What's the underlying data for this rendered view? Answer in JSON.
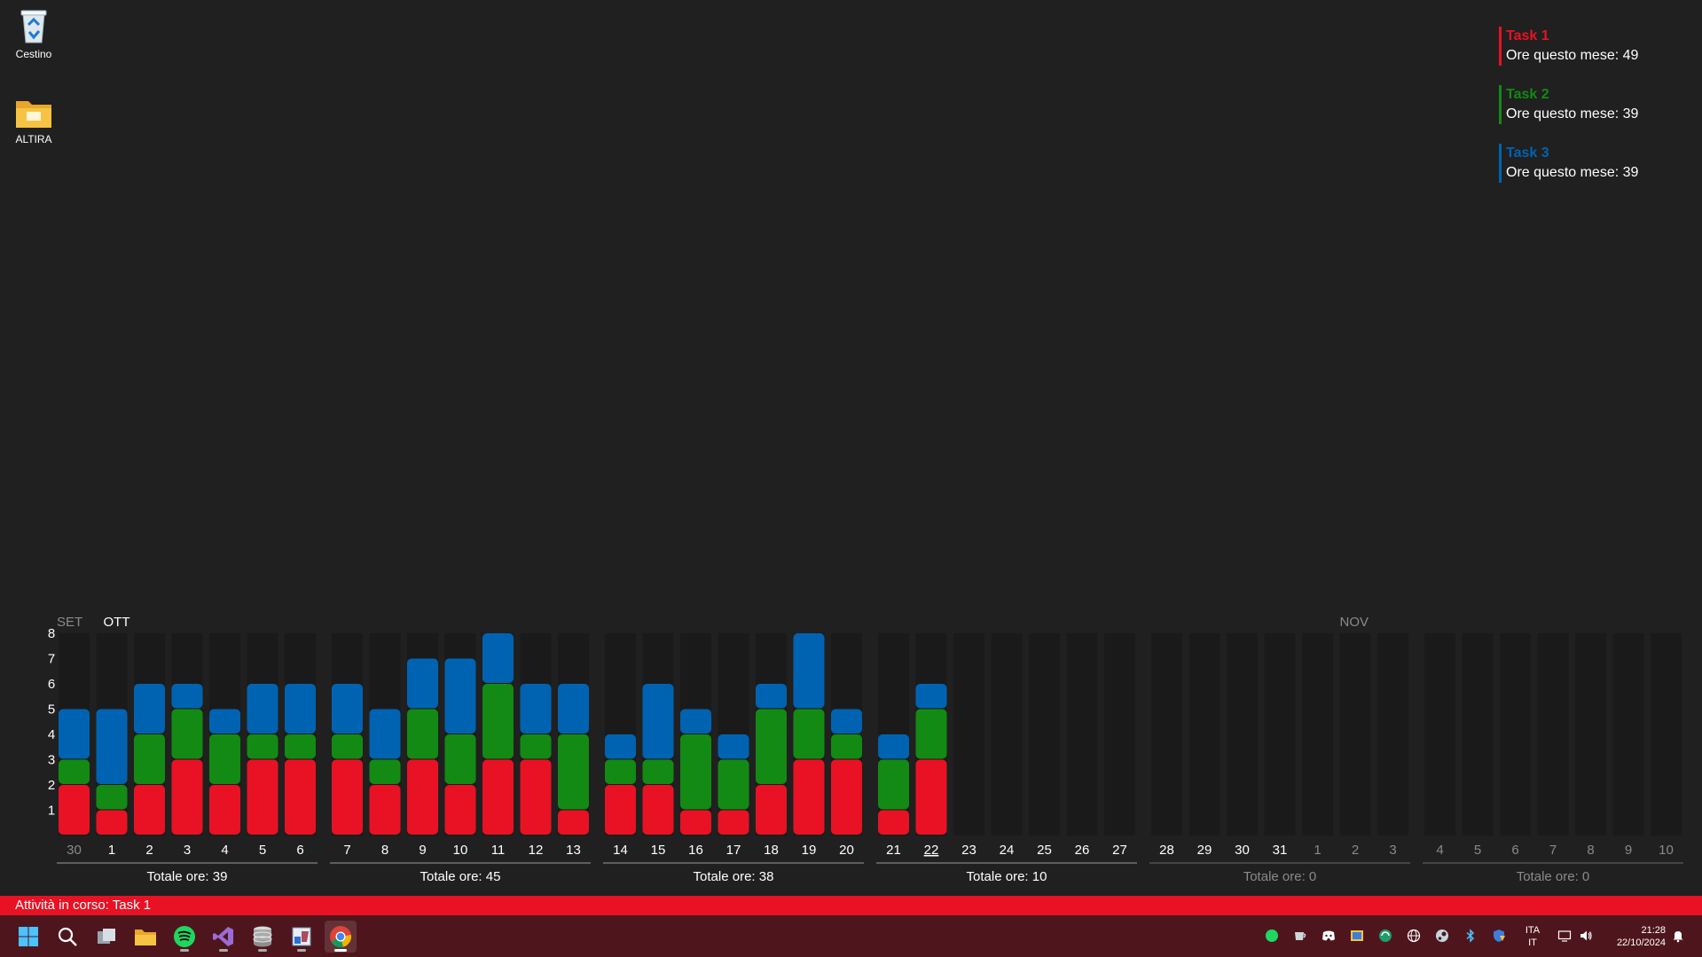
{
  "desktop": {
    "icons": [
      {
        "label": "Cestino"
      },
      {
        "label": "ALTIRA"
      }
    ]
  },
  "legend": {
    "items": [
      {
        "name": "Task 1",
        "hours_text": "Ore questo mese: 49",
        "color": "#e81224"
      },
      {
        "name": "Task 2",
        "hours_text": "Ore questo mese: 39",
        "color": "#138a13"
      },
      {
        "name": "Task 3",
        "hours_text": "Ore questo mese: 39",
        "color": "#0063b1"
      }
    ]
  },
  "chart_data": {
    "type": "bar",
    "stacked": true,
    "ylim": [
      0,
      8
    ],
    "y_ticks": [
      1,
      2,
      3,
      4,
      5,
      6,
      7,
      8
    ],
    "month_labels": [
      {
        "label": "SET",
        "at_index": 0,
        "dim": true
      },
      {
        "label": "OTT",
        "at_index": 1,
        "dim": false
      },
      {
        "label": "NOV",
        "at_index": 33,
        "dim": true
      }
    ],
    "categories": [
      "30",
      "1",
      "2",
      "3",
      "4",
      "5",
      "6",
      "7",
      "8",
      "9",
      "10",
      "11",
      "12",
      "13",
      "14",
      "15",
      "16",
      "17",
      "18",
      "19",
      "20",
      "21",
      "22",
      "23",
      "24",
      "25",
      "26",
      "27",
      "28",
      "29",
      "30",
      "31",
      "1",
      "2",
      "3",
      "4",
      "5",
      "6",
      "7",
      "8",
      "9",
      "10"
    ],
    "dim_day_index_ranges": [
      [
        0,
        0
      ],
      [
        32,
        41
      ]
    ],
    "today_index": 22,
    "series": [
      {
        "name": "Task 1",
        "color": "#e81224",
        "values": [
          2,
          1,
          2,
          3,
          2,
          3,
          3,
          3,
          2,
          3,
          2,
          3,
          3,
          1,
          2,
          2,
          1,
          1,
          2,
          3,
          3,
          1,
          3,
          0,
          0,
          0,
          0,
          0,
          0,
          0,
          0,
          0,
          0,
          0,
          0,
          0,
          0,
          0,
          0,
          0,
          0,
          0
        ]
      },
      {
        "name": "Task 2",
        "color": "#138a13",
        "values": [
          1,
          1,
          2,
          2,
          2,
          1,
          1,
          1,
          1,
          2,
          2,
          3,
          1,
          3,
          1,
          1,
          3,
          2,
          3,
          2,
          1,
          2,
          2,
          0,
          0,
          0,
          0,
          0,
          0,
          0,
          0,
          0,
          0,
          0,
          0,
          0,
          0,
          0,
          0,
          0,
          0,
          0
        ]
      },
      {
        "name": "Task 3",
        "color": "#0063b1",
        "values": [
          2,
          3,
          2,
          1,
          1,
          2,
          2,
          2,
          2,
          2,
          3,
          2,
          2,
          2,
          1,
          3,
          1,
          1,
          1,
          3,
          1,
          1,
          1,
          0,
          0,
          0,
          0,
          0,
          0,
          0,
          0,
          0,
          0,
          0,
          0,
          0,
          0,
          0,
          0,
          0,
          0,
          0
        ]
      }
    ],
    "weeks": [
      {
        "label": "Totale ore: 39",
        "dim": false
      },
      {
        "label": "Totale ore: 45",
        "dim": false
      },
      {
        "label": "Totale ore: 38",
        "dim": false
      },
      {
        "label": "Totale ore: 10",
        "dim": false
      },
      {
        "label": "Totale ore: 0",
        "dim": true
      },
      {
        "label": "Totale ore: 0",
        "dim": true
      }
    ]
  },
  "status": {
    "text": "Attività in corso: Task 1",
    "color": "#e81224"
  },
  "taskbar": {
    "apps": [
      {
        "icon": "windows-start-icon"
      },
      {
        "icon": "search-icon"
      },
      {
        "icon": "task-view-icon"
      },
      {
        "icon": "file-explorer-icon"
      },
      {
        "icon": "spotify-icon"
      },
      {
        "icon": "visual-studio-icon"
      },
      {
        "icon": "database-icon"
      },
      {
        "icon": "paint-icon"
      },
      {
        "icon": "chrome-icon"
      }
    ],
    "tray": {
      "lang_top": "ITA",
      "lang_bottom": "IT",
      "time": "21:28",
      "date": "22/10/2024"
    }
  }
}
